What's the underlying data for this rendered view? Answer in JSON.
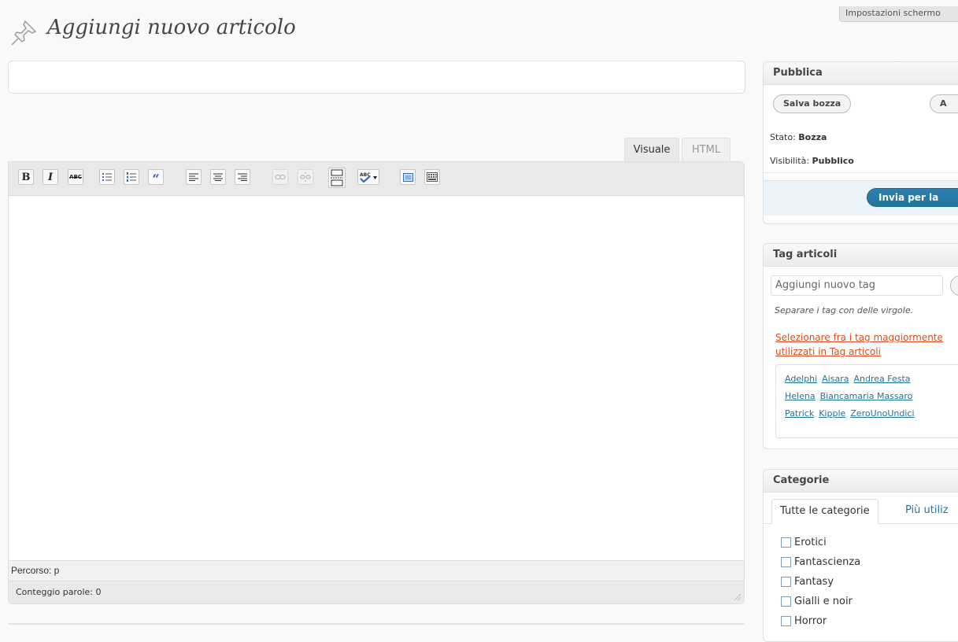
{
  "header": {
    "screen_options_label": "Impostazioni schermo",
    "page_title": "Aggiungi nuovo articolo"
  },
  "editor": {
    "title_value": "",
    "tab_visual": "Visuale",
    "tab_html": "HTML",
    "path_label": "Percorso: p",
    "word_count_label": "Conteggio parole: 0",
    "toolbar_buttons": [
      "bold",
      "italic",
      "strikethrough",
      "bullet-list",
      "numbered-list",
      "blockquote",
      "align-left",
      "align-center",
      "align-right",
      "link",
      "unlink",
      "more",
      "spellcheck",
      "fullscreen",
      "kitchen-sink"
    ]
  },
  "publish": {
    "heading": "Pubblica",
    "save_draft_label": "Salva bozza",
    "preview_label": "A",
    "status_label": "Stato:",
    "status_value": "Bozza",
    "visibility_label": "Visibilità:",
    "visibility_value": "Pubblico",
    "submit_label": "Invia per la"
  },
  "tags": {
    "heading": "Tag articoli",
    "input_placeholder": "Aggiungi nuovo tag",
    "hint": "Separare i tag con delle virgole.",
    "popular_link": "Selezionare fra i tag maggiormente utilizzati in Tag articoli",
    "cloud": [
      "Adelphi",
      "Aisara",
      "Andrea Festa",
      "Helena",
      "Biancamaria Massaro",
      "Patrick",
      "Kipple",
      "ZeroUnoUndici"
    ]
  },
  "categories": {
    "heading": "Categorie",
    "tab_all": "Tutte le categorie",
    "tab_popular": "Più utiliz",
    "items": [
      "Erotici",
      "Fantascienza",
      "Fantasy",
      "Gialli e noir",
      "Horror"
    ]
  },
  "colors": {
    "link": "#21759b",
    "popular_link": "#d54e21",
    "primary_button": "#21759b"
  }
}
